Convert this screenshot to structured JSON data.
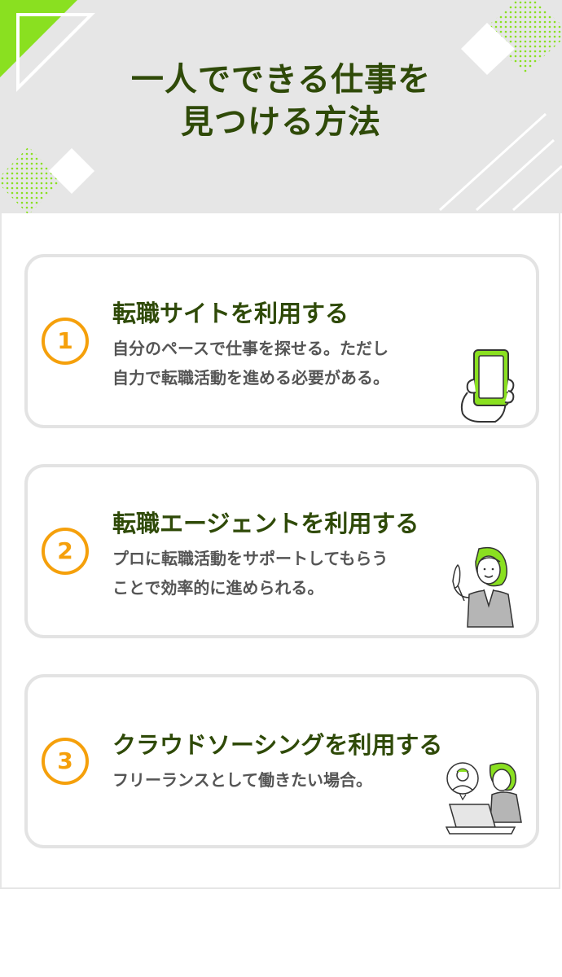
{
  "header": {
    "title_line1": "一人でできる仕事を",
    "title_line2": "見つける方法"
  },
  "colors": {
    "title": "#2f4a08",
    "accent_green": "#8ae020",
    "number_orange": "#f5a00b",
    "header_bg": "#e6e6e6",
    "card_border": "#e3e3e3"
  },
  "items": [
    {
      "number": "1",
      "title": "転職サイトを利用する",
      "desc_line1": "自分のペースで仕事を探せる。ただし",
      "desc_line2": "自力で転職活動を進める必要がある。",
      "icon": "smartphone-in-hand-icon"
    },
    {
      "number": "2",
      "title": "転職エージェントを利用する",
      "desc_line1": "プロに転職活動をサポートしてもらう",
      "desc_line2": "ことで効率的に進められる。",
      "icon": "agent-woman-pointing-icon"
    },
    {
      "number": "3",
      "title": "クラウドソーシングを利用する",
      "desc_line1": "フリーランスとして働きたい場合。",
      "icon": "laptop-video-call-icon"
    }
  ]
}
